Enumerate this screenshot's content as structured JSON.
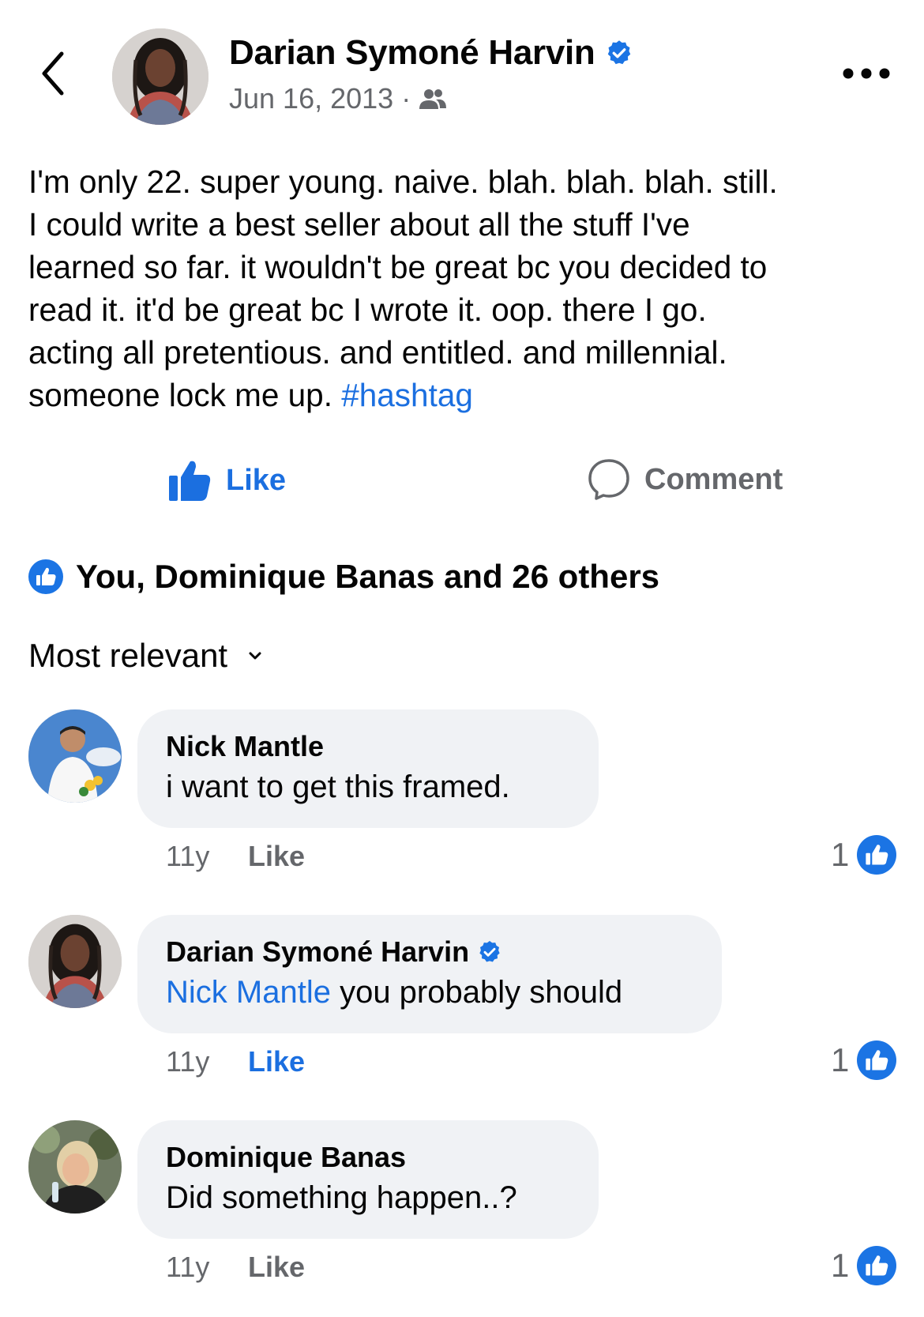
{
  "header": {
    "back_icon": "chevron-left-icon",
    "author": "Darian Symoné Harvin",
    "date": "Jun 16, 2013",
    "separator": "·",
    "audience_icon": "friends-icon",
    "more_icon": "more-horizontal-icon"
  },
  "post": {
    "lines": [
      "I'm only 22. super young. naive. blah. blah. blah. still.",
      "I could write a best seller about all the stuff I've",
      "learned so far. it wouldn't be great bc you decided to",
      "read it. it'd be great bc I wrote it. oop. there I go.",
      "acting all pretentious. and entitled. and millennial."
    ],
    "last_line_text": "someone lock me up.",
    "hashtag": "#hashtag"
  },
  "actions": {
    "like_label": "Like",
    "comment_label": "Comment"
  },
  "reactions": {
    "summary": "You, Dominique Banas and 26 others"
  },
  "sort": {
    "label": "Most relevant"
  },
  "comments": [
    {
      "name": "Nick Mantle",
      "text": "i want to get this framed.",
      "time": "11y",
      "like_label": "Like",
      "liked": false,
      "count": "1"
    },
    {
      "name": "Darian Symoné Harvin",
      "mention": "Nick Mantle",
      "text": "you probably should",
      "time": "11y",
      "like_label": "Like",
      "liked": true,
      "count": "1"
    },
    {
      "name": "Dominique Banas",
      "text": "Did something happen..?",
      "time": "11y",
      "like_label": "Like",
      "liked": false,
      "count": "1"
    }
  ],
  "colors": {
    "accent_blue": "#1b6fe0",
    "secondary_text": "#65676b",
    "bubble_bg": "#f0f2f5"
  }
}
